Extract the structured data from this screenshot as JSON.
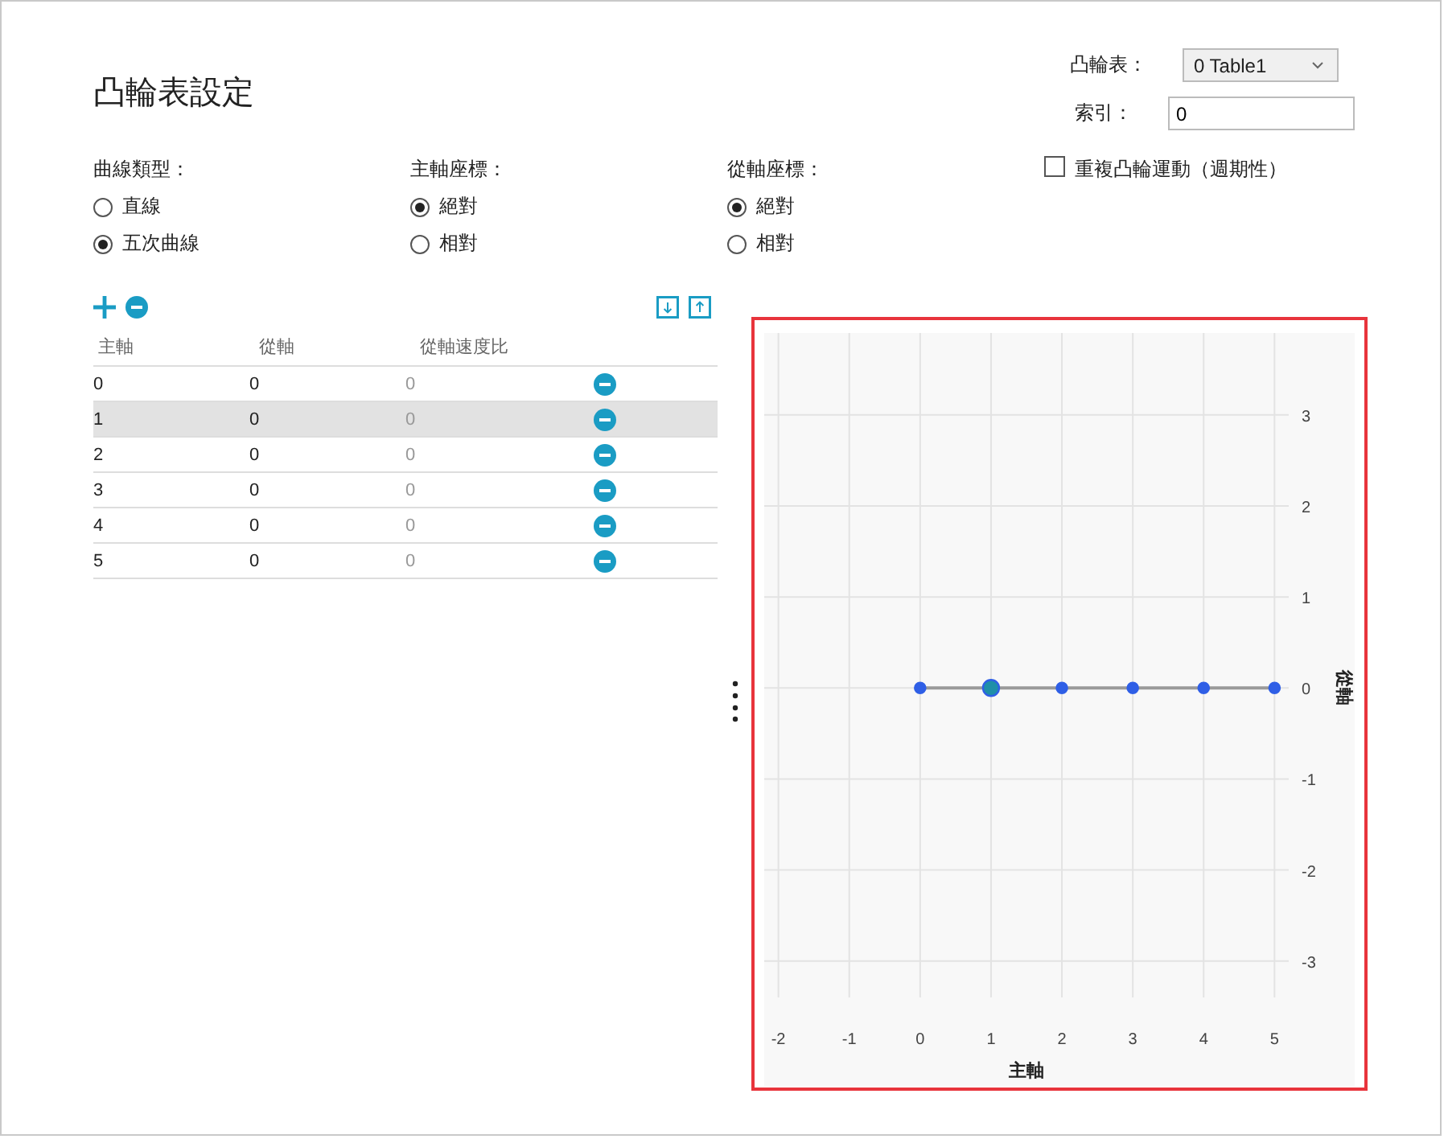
{
  "title": "凸輪表設定",
  "cam_table": {
    "label": "凸輪表：",
    "value": "0 Table1"
  },
  "index": {
    "label": "索引：",
    "value": "0"
  },
  "option_groups": [
    {
      "label": "曲線類型：",
      "options": [
        {
          "label": "直線",
          "selected": false
        },
        {
          "label": "五次曲線",
          "selected": true
        }
      ]
    },
    {
      "label": "主軸座標：",
      "options": [
        {
          "label": "絕對",
          "selected": true
        },
        {
          "label": "相對",
          "selected": false
        }
      ]
    },
    {
      "label": "從軸座標：",
      "options": [
        {
          "label": "絕對",
          "selected": true
        },
        {
          "label": "相對",
          "selected": false
        }
      ]
    }
  ],
  "repeat_checkbox": {
    "label": "重複凸輪運動（週期性）",
    "checked": false
  },
  "table": {
    "columns": [
      "主軸",
      "從軸",
      "從軸速度比"
    ],
    "rows": [
      {
        "cells": [
          "0",
          "0",
          "0"
        ],
        "selected": false
      },
      {
        "cells": [
          "1",
          "0",
          "0"
        ],
        "selected": true
      },
      {
        "cells": [
          "2",
          "0",
          "0"
        ],
        "selected": false
      },
      {
        "cells": [
          "3",
          "0",
          "0"
        ],
        "selected": false
      },
      {
        "cells": [
          "4",
          "0",
          "0"
        ],
        "selected": false
      },
      {
        "cells": [
          "5",
          "0",
          "0"
        ],
        "selected": false
      }
    ]
  },
  "chart": {
    "chart_data": {
      "type": "line",
      "xlabel": "主軸",
      "ylabel": "從軸",
      "x": [
        0,
        1,
        2,
        3,
        4,
        5
      ],
      "series": [
        {
          "color": "#2f5fe6",
          "marker": true,
          "values": [
            0,
            0,
            0,
            0,
            0,
            0
          ]
        }
      ],
      "grid": true,
      "xlim": [
        -2.2,
        5.2
      ],
      "ylim": [
        -3.4,
        3.9
      ],
      "xticks": [
        -2,
        -1,
        0,
        1,
        2,
        3,
        4,
        5
      ],
      "yticks": [
        -3,
        -2,
        -1,
        0,
        1,
        2,
        3
      ]
    }
  }
}
